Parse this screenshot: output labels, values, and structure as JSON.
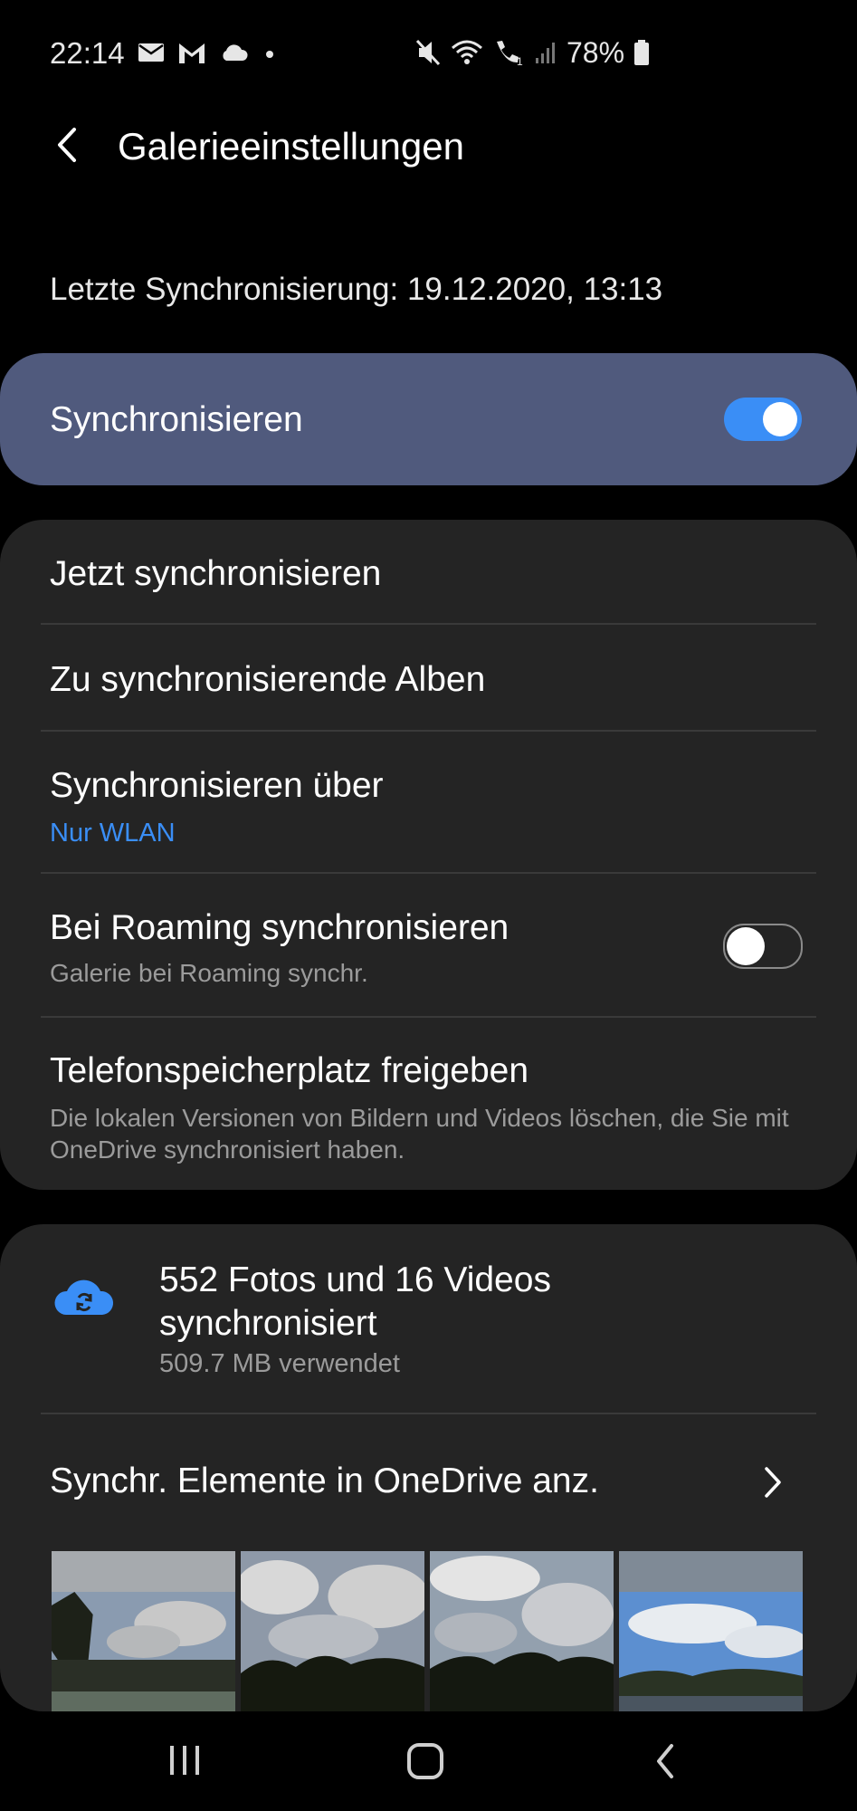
{
  "status_bar": {
    "time": "22:14",
    "battery": "78%",
    "left_icons": [
      "mail-icon",
      "gmail-icon",
      "cloud-icon",
      "dot-icon"
    ],
    "right_icons": [
      "mute-icon",
      "wifi-icon",
      "wifi-call-icon",
      "signal-icon",
      "battery-icon"
    ]
  },
  "header": {
    "title": "Galerieeinstellungen"
  },
  "last_sync": "Letzte Synchronisierung: 19.12.2020, 13:13",
  "sync_toggle": {
    "label": "Synchronisieren",
    "enabled": true
  },
  "settings": {
    "sync_now": "Jetzt synchronisieren",
    "albums": "Zu synchronisierende Alben",
    "sync_via": {
      "title": "Synchronisieren über",
      "value": "Nur WLAN"
    },
    "roaming": {
      "title": "Bei Roaming synchronisieren",
      "subtitle": "Galerie bei Roaming synchr.",
      "enabled": false
    },
    "free_space": {
      "title": "Telefonspeicherplatz freigeben",
      "subtitle": "Die lokalen Versionen von Bildern und Videos löschen, die Sie mit OneDrive synchronisiert haben."
    }
  },
  "onedrive": {
    "summary": "552 Fotos und 16 Videos synchronisiert",
    "used": "509.7 MB verwendet",
    "view_items": "Synchr. Elemente in OneDrive anz.",
    "thumbnails": [
      "sky-photo-1",
      "sky-photo-2",
      "sky-photo-3",
      "sky-photo-4"
    ]
  },
  "colors": {
    "accent": "#3a8ef6",
    "sync_card": "#505a7d",
    "card": "#242424",
    "background": "#000000"
  }
}
